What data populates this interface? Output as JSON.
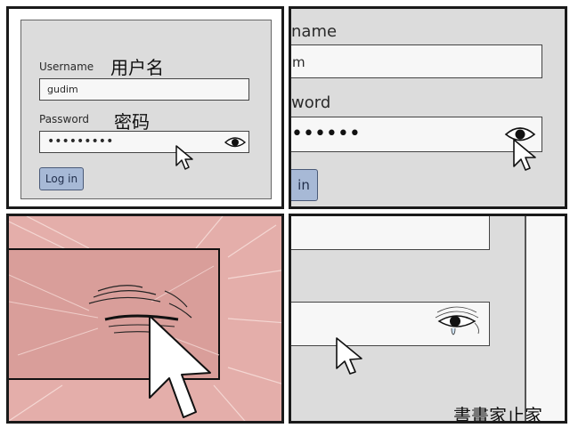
{
  "panel1": {
    "username_label": "Username",
    "username_annotation": "用户名",
    "username_value": "gudim",
    "password_label": "Password",
    "password_annotation": "密码",
    "password_value": "•••••••••",
    "login_button": "Log in"
  },
  "panel2": {
    "username_label_partial": "name",
    "username_value_partial": "m",
    "password_label_partial": "word",
    "password_value": "••••••",
    "login_button_partial": "in"
  },
  "watermark": "書畫家止家",
  "colors": {
    "panel_gray": "#dcdcdc",
    "button_blue": "#a7b9d6",
    "skin_pink": "#e4aeaa",
    "border": "#1a1a1a"
  }
}
